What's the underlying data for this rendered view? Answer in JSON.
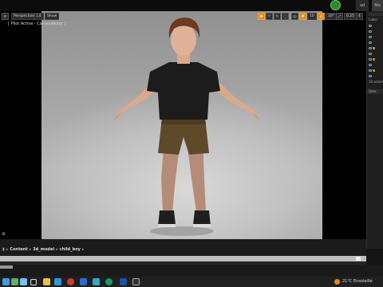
{
  "colors": {
    "accent_orange": "#e08a1a",
    "play_green": "#2e8a2e",
    "scene_bg": "#b5b5b5"
  },
  "topbar": {
    "right_btn_a": "ad",
    "right_btn_b": "Ma"
  },
  "viewport": {
    "toolbar": {
      "perspective_label": "Perspective",
      "lit_label": "Lit",
      "show_label": "Show",
      "snap_value": "10",
      "angle_value": "10°",
      "scale_value": "0.25",
      "cam_speed": "4"
    },
    "pilot_label": "[ Pilot Active - CameraActor ]",
    "gizmo_icon": "axis-gizmo-icon"
  },
  "right_panel": {
    "label_top": "Label",
    "rows": [
      "",
      "",
      "",
      "",
      "",
      "",
      "",
      "",
      ""
    ],
    "count_text": "16 actors",
    "details_label": "Deta"
  },
  "content_bar": {
    "breadcrumbs": [
      "Content",
      "3d_model",
      "child_boy"
    ]
  },
  "taskbar": {
    "weather_temp": "21°C",
    "weather_text": "Ensoleillé"
  }
}
